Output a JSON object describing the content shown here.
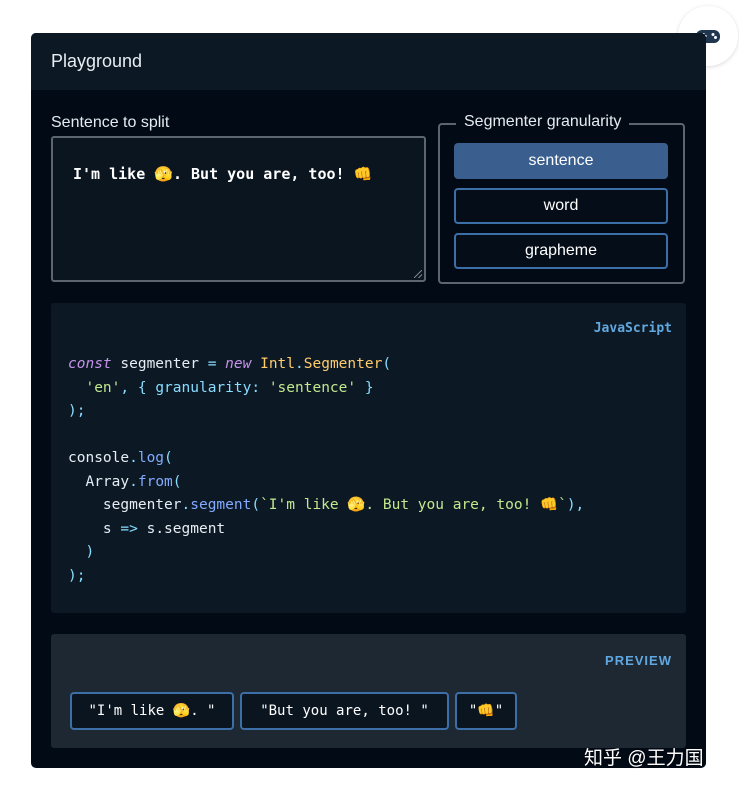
{
  "panel": {
    "title": "Playground"
  },
  "sentence": {
    "label": "Sentence to split",
    "value": "I'm like 🫣. But you are, too! 👊"
  },
  "granularity": {
    "legend": "Segmenter granularity",
    "options": [
      {
        "label": "sentence",
        "selected": true
      },
      {
        "label": "word",
        "selected": false
      },
      {
        "label": "grapheme",
        "selected": false
      }
    ]
  },
  "code": {
    "language": "JavaScript",
    "t": {
      "const": "const",
      "segmenter_decl": " segmenter ",
      "eq": "=",
      "new": "new",
      "intl": "Intl",
      "dot": ".",
      "segmenter_cls": "Segmenter",
      "open_paren": "(",
      "close_paren": ")",
      "indent2": "  ",
      "indent4": "    ",
      "en": "'en'",
      "comma": ",",
      "lbrace": "{",
      "rbrace": "}",
      "granularity_key": "granularity:",
      "sentence_str": "'sentence'",
      "close_stmt": ");",
      "console": "console",
      "log": "log",
      "array": "Array",
      "from": "from",
      "segmenter_var": "segmenter",
      "segment": "segment",
      "template_str": "`I'm like 🫣. But you are, too! 👊`",
      "close_call_comma": "),",
      "arrow_param": "s ",
      "arrow": "=>",
      "arrow_body": " s.segment"
    }
  },
  "preview": {
    "label": "PREVIEW",
    "segments": [
      "\"I'm like 🫣. \"",
      "\"But you are, too! \"",
      "\"👊\""
    ]
  },
  "watermark": "知乎 @王力国",
  "colors": {
    "panel_bg": "#020a15",
    "header_bg": "#0c1925",
    "accent": "#3c6ea8",
    "selected_button": "#3a5f8f",
    "label_accent": "#62a8e0"
  },
  "icons": {
    "corner": "gamepad-icon"
  }
}
